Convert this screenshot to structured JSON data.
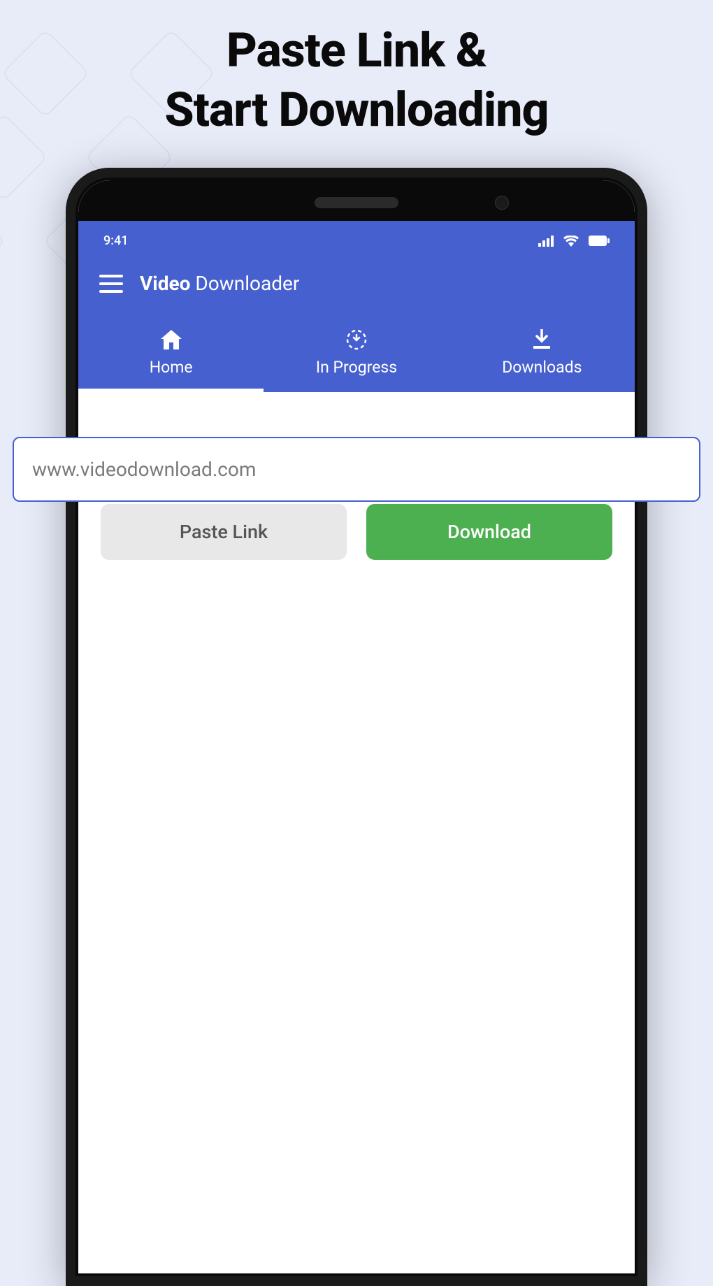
{
  "headline": {
    "line1": "Paste Link &",
    "line2": "Start Downloading"
  },
  "status_bar": {
    "time": "9:41"
  },
  "app": {
    "title_bold": "Video",
    "title_rest": " Downloader"
  },
  "tabs": [
    {
      "label": "Home",
      "icon": "home"
    },
    {
      "label": "In Progress",
      "icon": "progress"
    },
    {
      "label": "Downloads",
      "icon": "download"
    }
  ],
  "url_input": {
    "placeholder": "www.videodownload.com",
    "value": "www.videodownload.com"
  },
  "buttons": {
    "paste": "Paste Link",
    "download": "Download"
  }
}
